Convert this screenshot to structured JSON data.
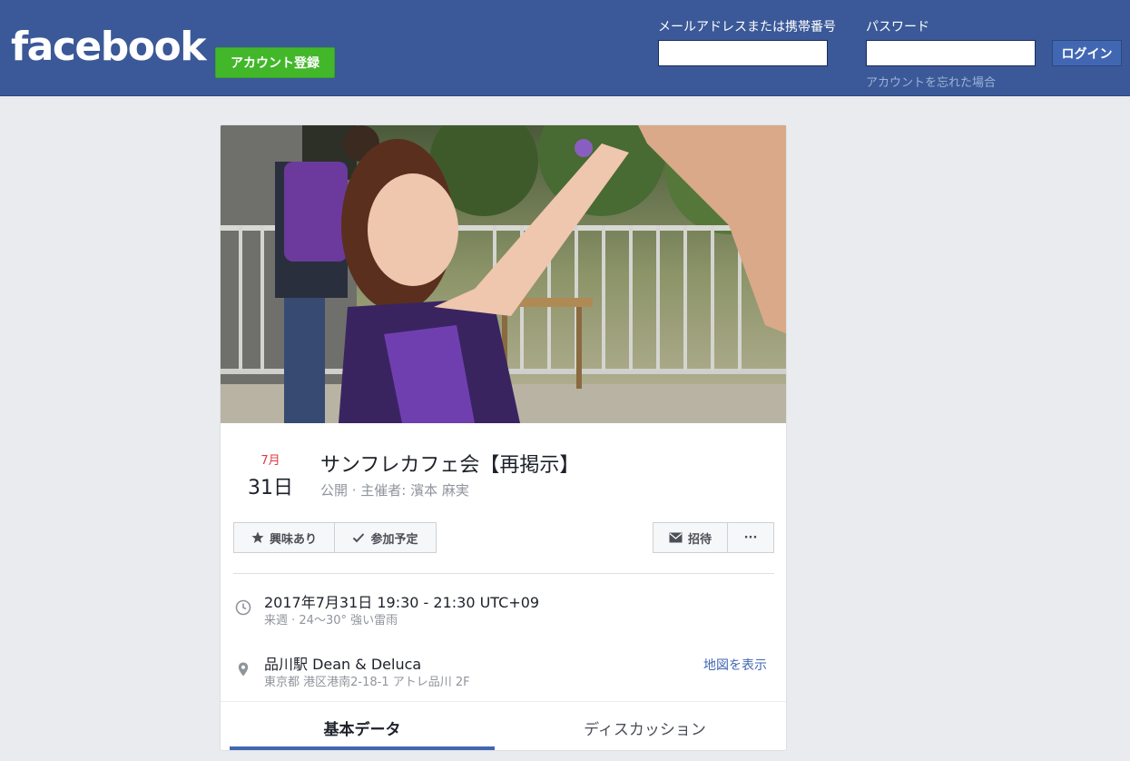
{
  "header": {
    "logo_text": "facebook",
    "signup_label": "アカウント登録",
    "email_label": "メールアドレスまたは携帯番号",
    "password_label": "パスワード",
    "login_label": "ログイン",
    "forgot_label": "アカウントを忘れた場合",
    "brand_color": "#3b5998",
    "signup_color": "#42b72a"
  },
  "event": {
    "month": "7月",
    "day": "31日",
    "title": "サンフレカフェ会【再掲示】",
    "subtitle": "公開 · 主催者: 濱本 麻実",
    "buttons": {
      "interested": "興味あり",
      "going": "参加予定",
      "invite": "招待",
      "more": "···"
    },
    "time": {
      "main": "2017年7月31日 19:30 - 21:30 UTC+09",
      "sub": "来週 · 24～30° 強い雷雨"
    },
    "location": {
      "main": "品川駅 Dean & Deluca",
      "sub": "東京都 港区港南2-18-1 アトレ品川 2F",
      "map_link": "地図を表示"
    },
    "tabs": {
      "about": "基本データ",
      "discussion": "ディスカッション"
    },
    "accent_color": "#4267b2"
  }
}
